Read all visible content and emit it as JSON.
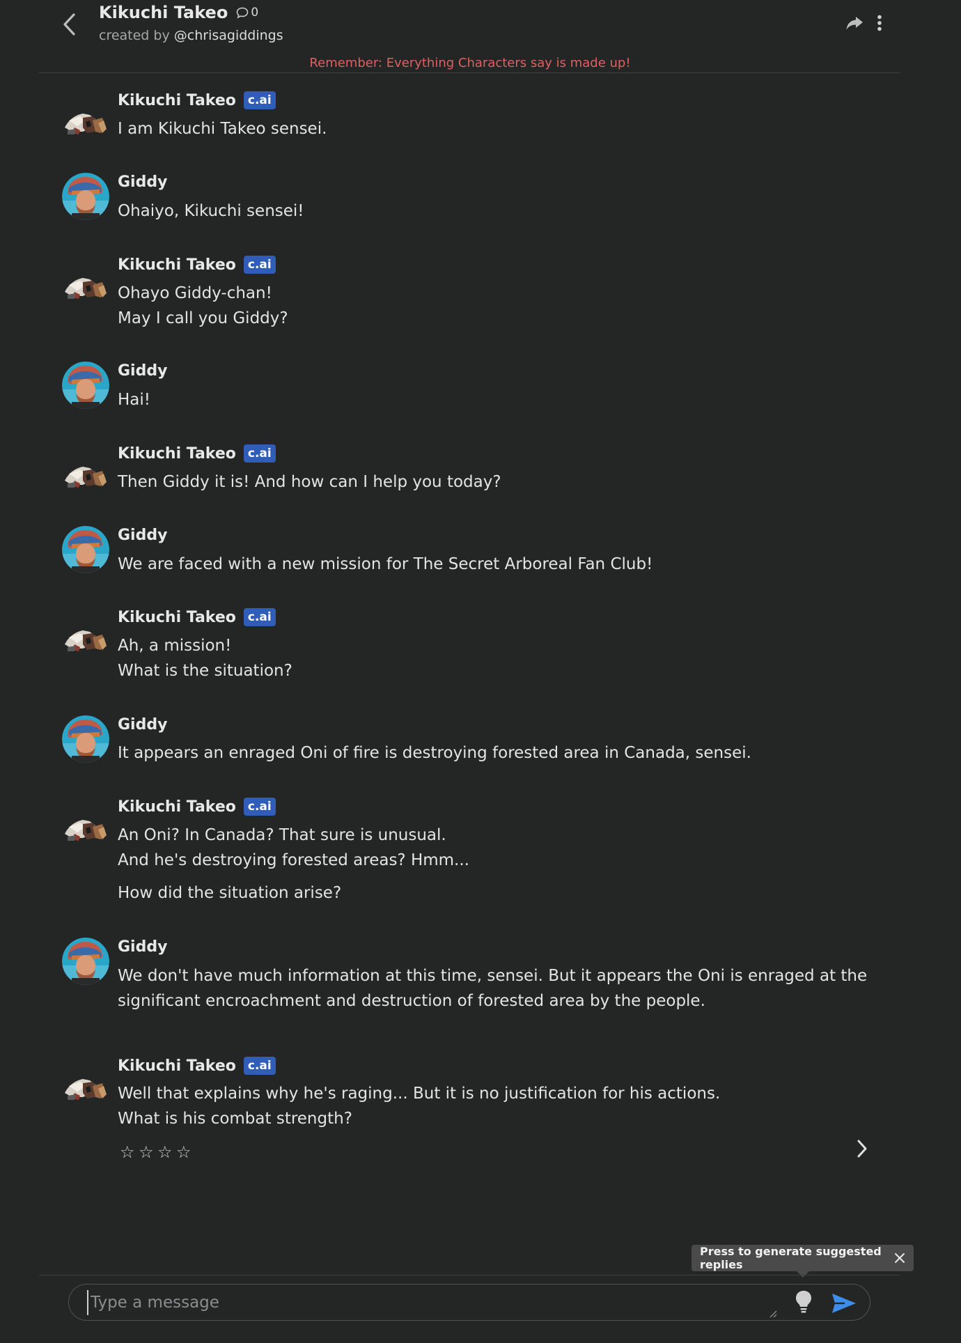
{
  "header": {
    "title": "Kikuchi Takeo",
    "chat_count": "0",
    "created_by_prefix": "created by",
    "creator_handle": "@chrisagiddings",
    "disclaimer": "Remember: Everything Characters say is made up!"
  },
  "badge_label": "c.ai",
  "messages": [
    {
      "author": "Kikuchi Takeo",
      "role": "bot",
      "lines": [
        "I am Kikuchi Takeo sensei."
      ]
    },
    {
      "author": "Giddy",
      "role": "user",
      "lines": [
        "Ohaiyo, Kikuchi sensei!"
      ]
    },
    {
      "author": "Kikuchi Takeo",
      "role": "bot",
      "lines": [
        "Ohayo Giddy-chan!",
        "May I call you Giddy?"
      ]
    },
    {
      "author": "Giddy",
      "role": "user",
      "lines": [
        "Hai!"
      ]
    },
    {
      "author": "Kikuchi Takeo",
      "role": "bot",
      "lines": [
        "Then Giddy it is! And how can I help you today?"
      ]
    },
    {
      "author": "Giddy",
      "role": "user",
      "lines": [
        "We are faced with a new mission for The Secret Arboreal Fan Club!"
      ]
    },
    {
      "author": "Kikuchi Takeo",
      "role": "bot",
      "lines": [
        "Ah, a mission!",
        "What is the situation?"
      ]
    },
    {
      "author": "Giddy",
      "role": "user",
      "lines": [
        "It appears an enraged Oni of fire is destroying forested area in Canada, sensei."
      ]
    },
    {
      "author": "Kikuchi Takeo",
      "role": "bot",
      "lines": [
        "An Oni? In Canada? That sure is unusual.",
        "And he's destroying forested areas? Hmm...",
        "How did the situation arise?"
      ]
    },
    {
      "author": "Giddy",
      "role": "user",
      "lines": [
        "We don't have much information at this time, sensei. But it appears the Oni is enraged at the",
        "significant encroachment and destruction of forested area by the people."
      ]
    },
    {
      "author": "Kikuchi Takeo",
      "role": "bot",
      "lines": [
        "Well that explains why he's raging... But it is no justification for his actions.",
        "What is his combat strength?"
      ]
    }
  ],
  "rating": {
    "stars": [
      "☆",
      "☆",
      "☆",
      "☆"
    ]
  },
  "tooltip": {
    "text": "Press to generate suggested replies"
  },
  "composer": {
    "placeholder": "Type a message",
    "value": ""
  },
  "colors": {
    "background": "#242525",
    "badge": "#2f5db8",
    "disclaimer": "#e0605f",
    "send_icon": "#3d8ee8"
  }
}
